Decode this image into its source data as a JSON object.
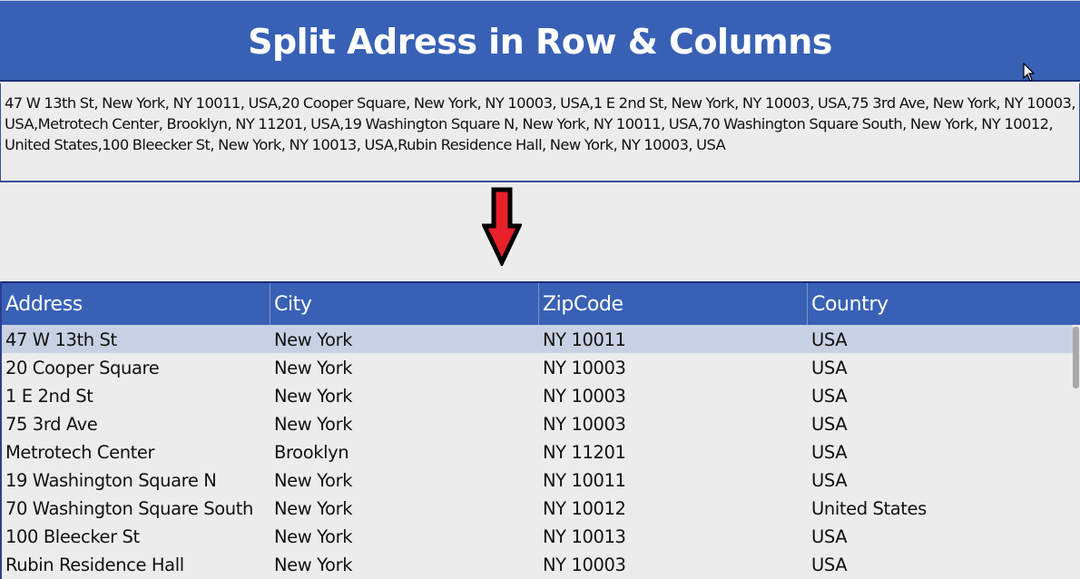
{
  "header": {
    "title": "Split Adress in Row & Columns"
  },
  "input": {
    "value": "47 W 13th St, New York, NY 10011, USA,20 Cooper Square, New York, NY 10003, USA,1 E 2nd St, New York, NY 10003, USA,75 3rd Ave, New York, NY 10003, USA,Metrotech Center, Brooklyn, NY 11201, USA,19 Washington Square N, New York, NY 10011, USA,70 Washington Square South, New York, NY 10012, United States,100 Bleecker St, New York, NY 10013, USA,Rubin Residence Hall, New York, NY 10003, USA"
  },
  "arrow": {
    "icon": "down-arrow-icon",
    "color": "#e8202a"
  },
  "table": {
    "columns": [
      "Address",
      "City",
      "ZipCode",
      "Country"
    ],
    "selected_row": 0,
    "rows": [
      [
        "47 W 13th St",
        "New York",
        "NY 10011",
        "USA"
      ],
      [
        "20 Cooper Square",
        "New York",
        "NY 10003",
        "USA"
      ],
      [
        "1 E 2nd St",
        "New York",
        "NY 10003",
        "USA"
      ],
      [
        "75 3rd Ave",
        "New York",
        "NY 10003",
        "USA"
      ],
      [
        "Metrotech Center",
        "Brooklyn",
        "NY 11201",
        "USA"
      ],
      [
        "19 Washington Square N",
        "New York",
        "NY 10011",
        "USA"
      ],
      [
        "70 Washington Square South",
        "New York",
        "NY 10012",
        "United States"
      ],
      [
        "100 Bleecker St",
        "New York",
        "NY 10013",
        "USA"
      ],
      [
        "Rubin Residence Hall",
        "New York",
        "NY 10003",
        "USA"
      ]
    ]
  },
  "colors": {
    "header_bg": "#3861b5",
    "selected_row_bg": "#c8d1e4",
    "page_bg": "#ececec"
  }
}
